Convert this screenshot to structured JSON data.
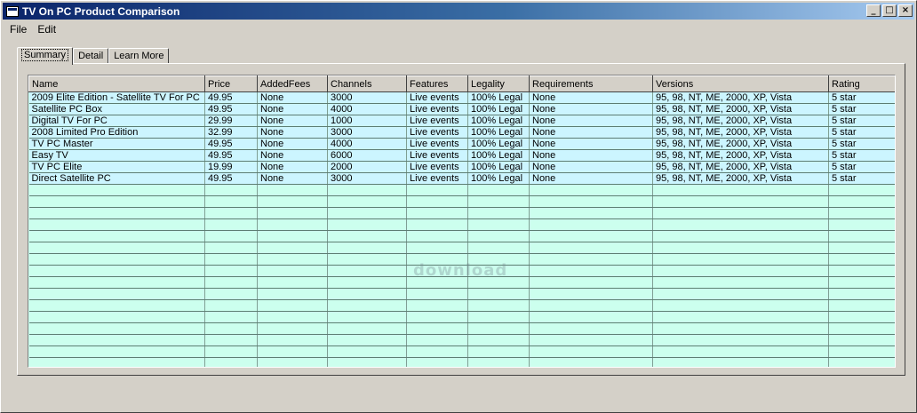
{
  "window": {
    "title": "TV On PC Product Comparison",
    "caption": {
      "minimize": "_",
      "maximize": "□",
      "close": "×"
    }
  },
  "menu": {
    "file": "File",
    "edit": "Edit"
  },
  "tabs": [
    {
      "label": "Summary"
    },
    {
      "label": "Detail"
    },
    {
      "label": "Learn More"
    }
  ],
  "table": {
    "columns": [
      "Name",
      "Price",
      "AddedFees",
      "Channels",
      "Features",
      "Legality",
      "Requirements",
      "Versions",
      "Rating"
    ],
    "rows": [
      [
        "2009 Elite Edition - Satellite TV For PC",
        "49.95",
        "None",
        "3000",
        "Live events",
        "100% Legal",
        "None",
        "95, 98, NT, ME, 2000, XP, Vista",
        "5 star"
      ],
      [
        "Satellite PC Box",
        "49.95",
        "None",
        "4000",
        "Live events",
        "100% Legal",
        "None",
        "95, 98, NT, ME, 2000, XP, Vista",
        "5 star"
      ],
      [
        "Digital TV For PC",
        "29.99",
        "None",
        "1000",
        "Live events",
        "100% Legal",
        "None",
        "95, 98, NT, ME, 2000, XP, Vista",
        "5 star"
      ],
      [
        "2008 Limited Pro Edition",
        "32.99",
        "None",
        "3000",
        "Live events",
        "100% Legal",
        "None",
        "95, 98, NT, ME, 2000, XP, Vista",
        "5 star"
      ],
      [
        "TV PC Master",
        "49.95",
        "None",
        "4000",
        "Live events",
        "100% Legal",
        "None",
        "95, 98, NT, ME, 2000, XP, Vista",
        "5 star"
      ],
      [
        "Easy TV",
        "49.95",
        "None",
        "6000",
        "Live events",
        "100% Legal",
        "None",
        "95, 98, NT, ME, 2000, XP, Vista",
        "5 star"
      ],
      [
        "TV PC Elite",
        "19.99",
        "None",
        "2000",
        "Live events",
        "100% Legal",
        "None",
        "95, 98, NT, ME, 2000, XP, Vista",
        "5 star"
      ],
      [
        "Direct Satellite PC",
        "49.95",
        "None",
        "3000",
        "Live events",
        "100% Legal",
        "None",
        "95, 98, NT, ME, 2000, XP, Vista",
        "5 star"
      ]
    ]
  },
  "watermark": "download",
  "colors": {
    "title_active": "#0a246a",
    "row_bg": "#ccf5ff",
    "empty_bg": "#ccffee"
  }
}
